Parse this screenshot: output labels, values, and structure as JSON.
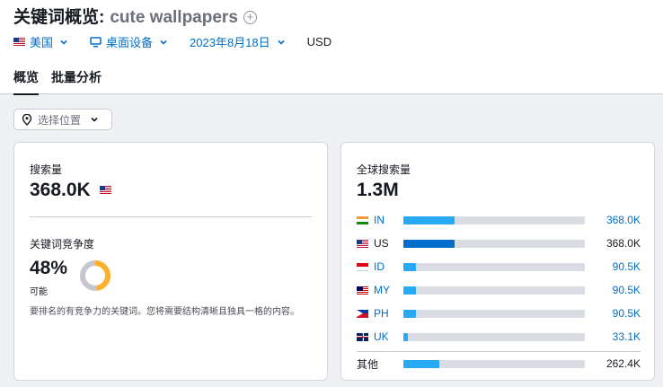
{
  "header": {
    "title_prefix": "关键词概览:",
    "keyword": "cute wallpapers",
    "add_icon": "plus-circle-icon"
  },
  "filters": {
    "country": "美国",
    "device": "桌面设备",
    "date": "2023年8月18日",
    "currency": "USD"
  },
  "tabs": [
    "概览",
    "批量分析"
  ],
  "location": {
    "placeholder": "选择位置"
  },
  "volume_card": {
    "label": "搜索量",
    "value": "368.0K",
    "kd_label": "关键词竞争度",
    "kd_value": "48%",
    "kd_percent": 48,
    "kd_status": "可能",
    "kd_color": "#fdb12b",
    "description": "要排名的有竞争力的关键词。您将需要结构清晰且独具一格的内容。"
  },
  "global_card": {
    "label": "全球搜索量",
    "value": "1.3M",
    "countries": [
      {
        "code": "IN",
        "value": "368.0K",
        "share": 0.28,
        "color": "#27aaf3",
        "linked": true
      },
      {
        "code": "US",
        "value": "368.0K",
        "share": 0.28,
        "color": "#006dca",
        "linked": false
      },
      {
        "code": "ID",
        "value": "90.5K",
        "share": 0.07,
        "color": "#27aaf3",
        "linked": true
      },
      {
        "code": "MY",
        "value": "90.5K",
        "share": 0.07,
        "color": "#27aaf3",
        "linked": true
      },
      {
        "code": "PH",
        "value": "90.5K",
        "share": 0.07,
        "color": "#27aaf3",
        "linked": true
      },
      {
        "code": "UK",
        "value": "33.1K",
        "share": 0.025,
        "color": "#27aaf3",
        "linked": true
      }
    ],
    "other": {
      "label": "其他",
      "value": "262.4K",
      "share": 0.2
    }
  }
}
